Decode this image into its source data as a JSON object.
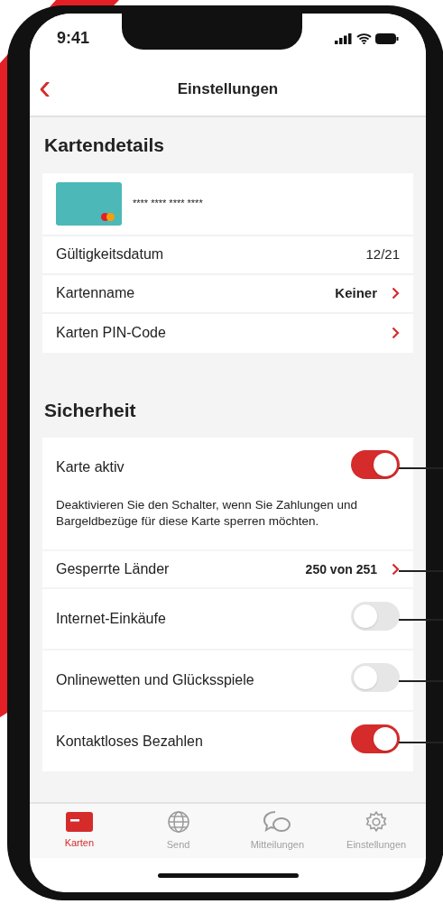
{
  "status_bar": {
    "time": "9:41"
  },
  "header": {
    "back": "‹",
    "title": "Einstellungen"
  },
  "card_details": {
    "title": "Kartendetails",
    "card_number": "**** **** **** ****",
    "rows": [
      {
        "label": "Gültigkeitsdatum",
        "value": "12/21",
        "chevron": false
      },
      {
        "label": "Kartenname",
        "value": "Keiner",
        "chevron": true
      },
      {
        "label": "Karten PIN-Code",
        "chevron": true
      }
    ]
  },
  "security": {
    "title": "Sicherheit",
    "items": [
      {
        "kind": "toggle",
        "label": "Karte aktiv",
        "on": true
      },
      {
        "kind": "note",
        "text": "Deaktivieren Sie den Schalter, wenn Sie Zahlungen und Bargeldbezüge für diese Karte sperren möchten."
      },
      {
        "kind": "link",
        "label": "Gesperrte Länder",
        "value": "250 von 251"
      },
      {
        "kind": "toggle",
        "label": "Internet-Einkäufe",
        "on": false
      },
      {
        "kind": "toggle",
        "label": "Onlinewetten und Glücksspiele",
        "on": false
      },
      {
        "kind": "toggle",
        "label": "Kontaktloses Bezahlen",
        "on": true
      }
    ]
  },
  "tab_bar": [
    {
      "kind": "card",
      "label": "Karten",
      "selected": true
    },
    {
      "kind": "globe",
      "label": "Send",
      "selected": false
    },
    {
      "kind": "chat",
      "label": "Mitteilungen",
      "selected": false
    },
    {
      "kind": "gear",
      "label": "Einstellungen",
      "selected": false
    }
  ]
}
